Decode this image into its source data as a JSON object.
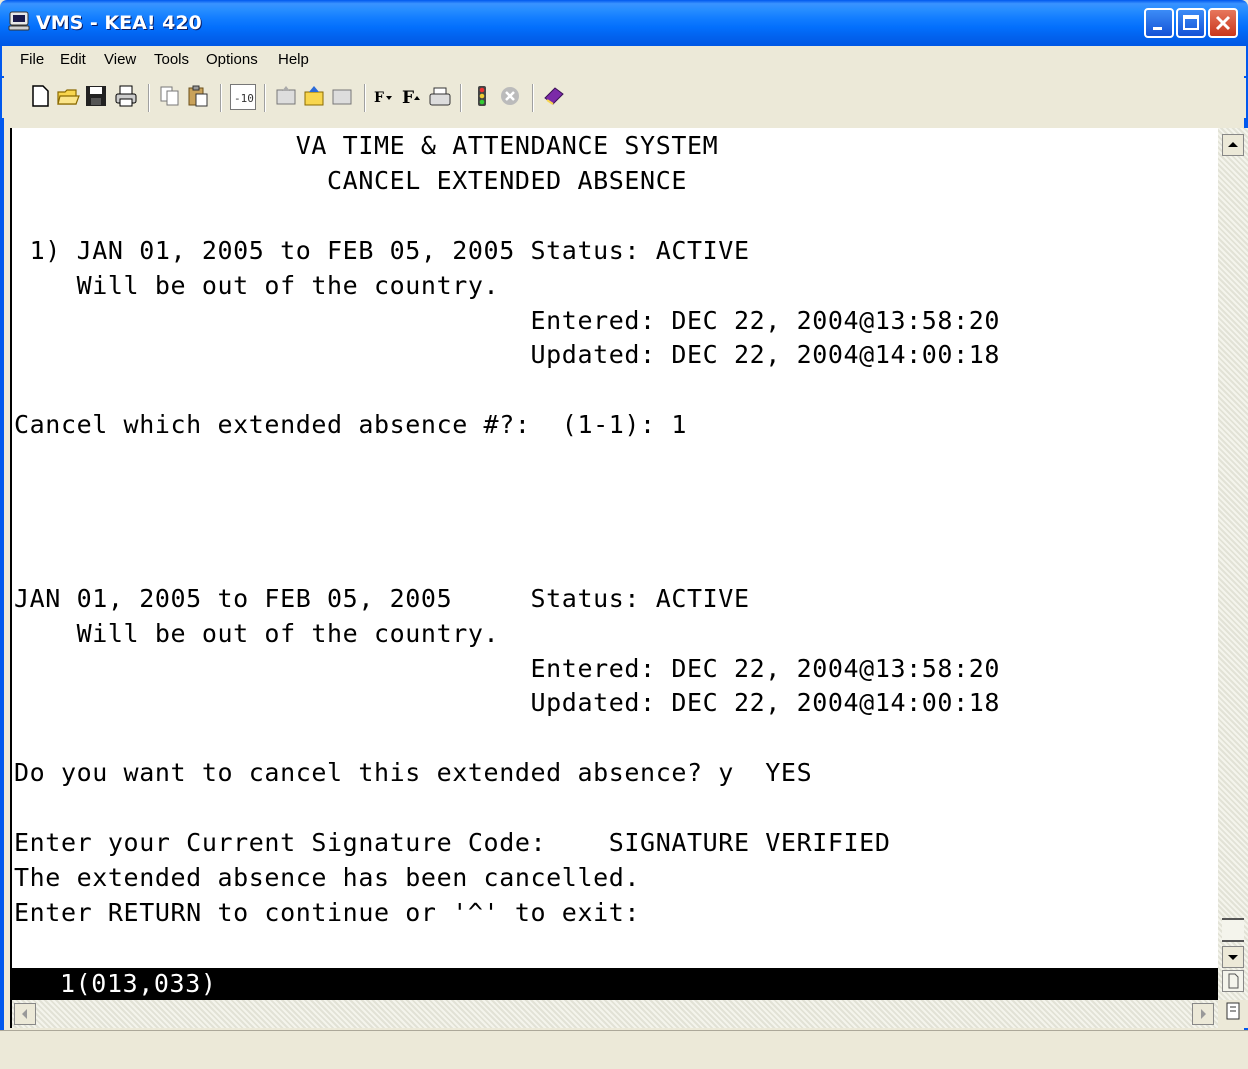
{
  "window": {
    "title": "VMS - KEA! 420"
  },
  "menu": {
    "items": [
      "File",
      "Edit",
      "View",
      "Tools",
      "Options",
      "Help"
    ]
  },
  "toolbar": {
    "icons": [
      "new-icon",
      "open-icon",
      "save-icon",
      "print-icon",
      "copy-icon",
      "paste-icon",
      "capture-icon",
      "send-icon",
      "receive-icon",
      "transfer-icon",
      "font-down-icon",
      "font-up-icon",
      "keyboard-icon",
      "stoplight-icon",
      "stop-icon",
      "book-icon"
    ]
  },
  "terminal": {
    "lines": [
      "                  VA TIME & ATTENDANCE SYSTEM",
      "                    CANCEL EXTENDED ABSENCE",
      "",
      " 1) JAN 01, 2005 to FEB 05, 2005 Status: ACTIVE",
      "    Will be out of the country.",
      "                                 Entered: DEC 22, 2004@13:58:20",
      "                                 Updated: DEC 22, 2004@14:00:18",
      "",
      "Cancel which extended absence #?:  (1-1): 1",
      "",
      "",
      "",
      "",
      "JAN 01, 2005 to FEB 05, 2005     Status: ACTIVE",
      "    Will be out of the country.",
      "                                 Entered: DEC 22, 2004@13:58:20",
      "                                 Updated: DEC 22, 2004@14:00:18",
      "",
      "Do you want to cancel this extended absence? y  YES",
      "",
      "Enter your Current Signature Code:    SIGNATURE VERIFIED",
      "The extended absence has been cancelled.",
      "Enter RETURN to continue or '^' to exit:"
    ],
    "status_line": "1(013,033)"
  }
}
